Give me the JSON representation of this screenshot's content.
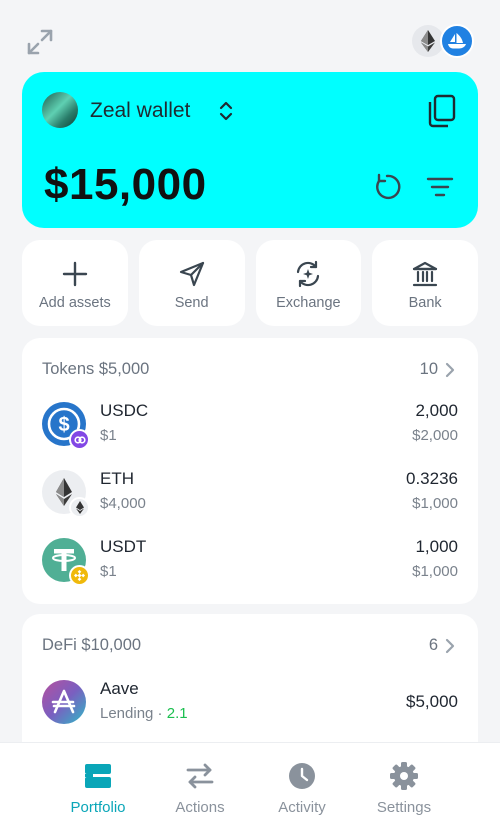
{
  "wallet": {
    "name": "Zeal wallet",
    "balance": "$15,000"
  },
  "quick_actions": [
    {
      "label": "Add assets",
      "icon": "plus-icon"
    },
    {
      "label": "Send",
      "icon": "send-icon"
    },
    {
      "label": "Exchange",
      "icon": "exchange-icon"
    },
    {
      "label": "Bank",
      "icon": "bank-icon"
    }
  ],
  "tokens": {
    "title": "Tokens $5,000",
    "count": "10",
    "items": [
      {
        "name": "USDC",
        "price": "$1",
        "amount": "2,000",
        "value": "$2,000",
        "icon": "usdc-icon",
        "badge": "polygon-badge-icon"
      },
      {
        "name": "ETH",
        "price": "$4,000",
        "amount": "0.3236",
        "value": "$1,000",
        "icon": "eth-icon",
        "badge": "ethereum-badge-icon"
      },
      {
        "name": "USDT",
        "price": "$1",
        "amount": "1,000",
        "value": "$1,000",
        "icon": "usdt-icon",
        "badge": "bnb-badge-icon"
      }
    ]
  },
  "defi": {
    "title": "DeFi $10,000",
    "count": "6",
    "items": [
      {
        "name": "Aave",
        "type": "Lending",
        "separator": " · ",
        "apy": "2.1",
        "value": "$5,000",
        "icon": "aave-icon"
      }
    ]
  },
  "nav": [
    {
      "label": "Portfolio",
      "icon": "portfolio-icon",
      "active": true
    },
    {
      "label": "Actions",
      "icon": "actions-icon",
      "active": false
    },
    {
      "label": "Activity",
      "icon": "activity-icon",
      "active": false
    },
    {
      "label": "Settings",
      "icon": "settings-icon",
      "active": false
    }
  ],
  "colors": {
    "accent": "#00ffff",
    "active_nav": "#0aa6b8",
    "apy_green": "#1bbf4f",
    "background": "#f4f5f7"
  }
}
